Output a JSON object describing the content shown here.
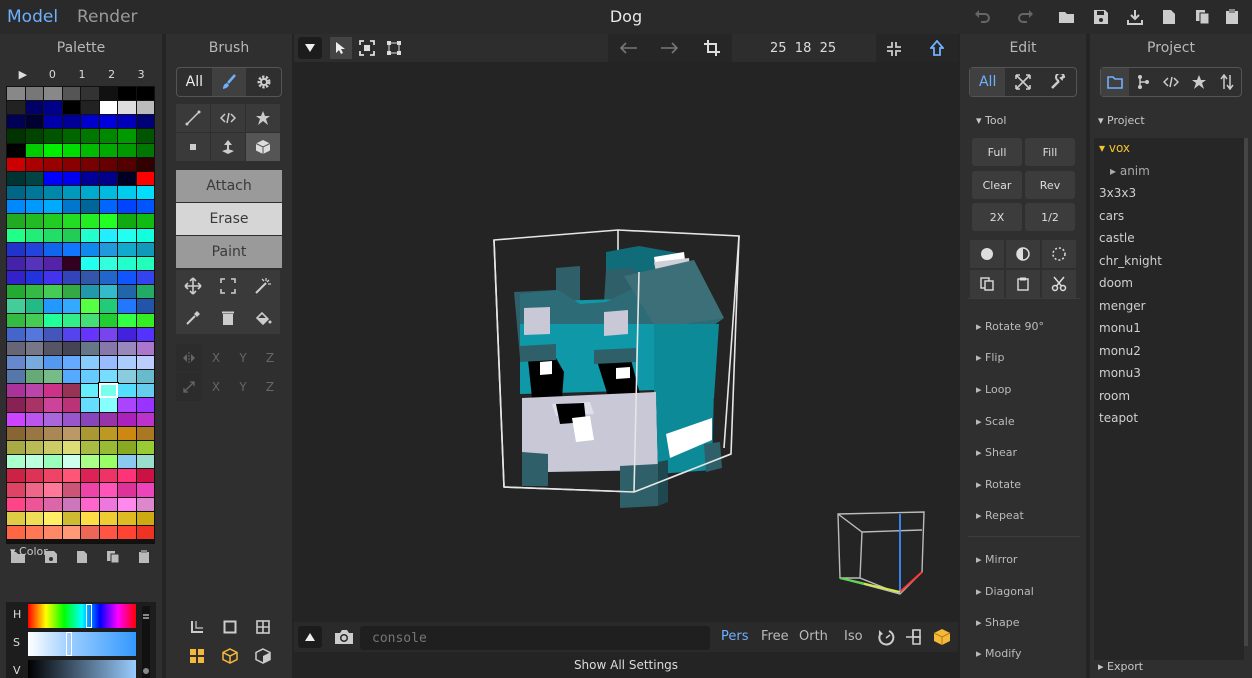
{
  "topbar": {
    "mode_tabs": [
      "Model",
      "Render"
    ],
    "title": "Dog",
    "icons": [
      "undo-icon",
      "redo-icon",
      "open-folder-icon",
      "save-icon",
      "download-icon",
      "new-file-icon",
      "copy-icon",
      "paste-icon"
    ]
  },
  "palette": {
    "title": "Palette",
    "columns": [
      "▶",
      "0",
      "1",
      "2",
      "3"
    ],
    "colors": [
      "#888888",
      "#777777",
      "#888888",
      "#555555",
      "#333333",
      "#111111",
      "#000000",
      "#000000",
      "#222222",
      "#000066",
      "#000088",
      "#000000",
      "#222222",
      "#ffffff",
      "#dddddd",
      "#bbbbbb",
      "#000055",
      "#000033",
      "#0000aa",
      "#000099",
      "#0000cc",
      "#0000dd",
      "#0000bb",
      "#000077",
      "#003300",
      "#004400",
      "#005500",
      "#006600",
      "#007700",
      "#008800",
      "#009900",
      "#005500",
      "#000000",
      "#00cc00",
      "#00ee00",
      "#00dd00",
      "#00bb00",
      "#00aa00",
      "#009900",
      "#007700",
      "#cc0000",
      "#aa0000",
      "#990000",
      "#880000",
      "#770000",
      "#660000",
      "#550000",
      "#330000",
      "#003333",
      "#004444",
      "#0000ff",
      "#0000ee",
      "#000099",
      "#000088",
      "#000022",
      "#ff0000",
      "#006688",
      "#007799",
      "#0088aa",
      "#0099bb",
      "#00aacc",
      "#00bbdd",
      "#00ccee",
      "#00ddff",
      "#0088ff",
      "#0099ff",
      "#00aaff",
      "#0077cc",
      "#006699",
      "#0066ff",
      "#0044ff",
      "#0055ff",
      "#22aa22",
      "#22bb22",
      "#22cc22",
      "#22dd22",
      "#22ee22",
      "#22ff22",
      "#11aa11",
      "#11bb11",
      "#22ff88",
      "#22ee77",
      "#22dd66",
      "#22cc55",
      "#22ffcc",
      "#22eeff",
      "#22ffee",
      "#11ffdd",
      "#2233cc",
      "#2244dd",
      "#1166ee",
      "#1177ff",
      "#1188ee",
      "#2299dd",
      "#11aacc",
      "#1199bb",
      "#4422aa",
      "#5533bb",
      "#5522aa",
      "#330022",
      "#22ffee",
      "#33ffdd",
      "#22ffcc",
      "#22ffbb",
      "#3322cc",
      "#2233dd",
      "#4433ee",
      "#3344bb",
      "#3355aa",
      "#2266cc",
      "#1155ff",
      "#3344ee",
      "#22aa33",
      "#33bb44",
      "#44cc55",
      "#33aa44",
      "#2299aa",
      "#33bbcc",
      "#2266aa",
      "#22aa66",
      "#44cc99",
      "#22bb88",
      "#2299ff",
      "#33aaff",
      "#55ff44",
      "#22cc77",
      "#2277ff",
      "#2255aa",
      "#33bb44",
      "#44cc55",
      "#22ff99",
      "#33ee88",
      "#44dd77",
      "#22cc33",
      "#33ff44",
      "#33ee22",
      "#4466cc",
      "#5577dd",
      "#4455bb",
      "#5544ee",
      "#6633ff",
      "#7744ee",
      "#4422dd",
      "#5533ff",
      "#666677",
      "#777788",
      "#555566",
      "#444455",
      "#667788",
      "#8877aa",
      "#9988bb",
      "#aa77cc",
      "#6688cc",
      "#77aadd",
      "#5599ee",
      "#66aaff",
      "#88ccff",
      "#99bbff",
      "#aaccff",
      "#bbccff",
      "#5577aa",
      "#66aa77",
      "#77bb88",
      "#55aaff",
      "#66ccff",
      "#77ddff",
      "#88ccdd",
      "#66bbcc",
      "#aa3399",
      "#bb44aa",
      "#cc3388",
      "#993355",
      "#66eeff",
      "#77ffee",
      "#55ddff",
      "#66ccee",
      "#882255",
      "#aa3366",
      "#cc4499",
      "#bb3377",
      "#66ddff",
      "#88ffff",
      "#aa44ff",
      "#9933ff",
      "#cc44ff",
      "#bb55ee",
      "#aa66dd",
      "#9955cc",
      "#8844bb",
      "#9933aa",
      "#aa22bb",
      "#bb33cc",
      "#886633",
      "#997744",
      "#aa8855",
      "#bb9966",
      "#aa9933",
      "#bb9922",
      "#cc8811",
      "#aa7722",
      "#aaaa44",
      "#bbbb55",
      "#cccc66",
      "#dddd77",
      "#aabb44",
      "#99bb33",
      "#88aa22",
      "#99cc33",
      "#aaffcc",
      "#bbffdd",
      "#99ffbb",
      "#ccffee",
      "#aaff88",
      "#99ff66",
      "#8acaf0",
      "#99ddcc",
      "#cc2244",
      "#dd3355",
      "#ee4466",
      "#ff5577",
      "#dd2255",
      "#ee3366",
      "#ff3377",
      "#cc1144",
      "#dd4466",
      "#ee6688",
      "#ff7799",
      "#cc5577",
      "#ee44aa",
      "#ff55bb",
      "#dd3399",
      "#ee44bb",
      "#ff4488",
      "#ee5599",
      "#dd66aa",
      "#cc77bb",
      "#ff66cc",
      "#ee77dd",
      "#ff88ee",
      "#dd88cc",
      "#ddcc44",
      "#eedd55",
      "#ffee66",
      "#ccbb33",
      "#ffdd44",
      "#eecc33",
      "#ddbb22",
      "#ccaa11",
      "#ff6644",
      "#ff7755",
      "#ff8866",
      "#ff9977",
      "#ee6655",
      "#ff5544",
      "#ff4433",
      "#ee3322",
      "#ffcc44",
      "#ffdd55",
      "#ffee77",
      "#ffaa33",
      "#ffbb44",
      "#ffcc66",
      "#ff9933",
      "#ffaa55",
      "#ff66cc",
      "#ff77dd",
      "#ff88ee",
      "#ff55bb",
      "#ff44aa",
      "#ff3399",
      "#ff2288",
      "#ff1177",
      "#ffee44",
      "#ffff55",
      "#ffff66",
      "#ffee33",
      "#ffdd22",
      "#ffcc11",
      "#ffbb00",
      "#ffaa00",
      "#ff99aa",
      "#ffaabb",
      "#ffbbcc",
      "#ffccdd",
      "#ffddee",
      "#ffeeff",
      "#ffcccc",
      "#ffdddd"
    ],
    "selected_index": 173,
    "tools": [
      "open-folder-icon",
      "save-icon",
      "new-file-icon",
      "copy-icon",
      "paste-icon"
    ]
  },
  "color": {
    "label": "Color",
    "h": "H",
    "s": "S",
    "v": "V",
    "current_hex": "#99ccff",
    "r": "153",
    "g": "204",
    "b": "255"
  },
  "brush": {
    "title": "Brush",
    "tabs": [
      "All"
    ],
    "modes": [
      "Attach",
      "Erase",
      "Paint"
    ],
    "active_mode": "Erase",
    "axis": [
      "X",
      "Y",
      "Z"
    ]
  },
  "viewport": {
    "size_readout": "25  18  25",
    "console_placeholder": "console",
    "views": [
      "Pers",
      "Free",
      "Orth",
      "Iso"
    ],
    "active_view": "Pers",
    "show_all": "Show All Settings"
  },
  "edit": {
    "title": "Edit",
    "tab_all": "All",
    "tool_label": "Tool",
    "buttons": [
      "Full",
      "Fill",
      "Clear",
      "Rev",
      "2X",
      "1/2"
    ],
    "sections": [
      "Rotate 90°",
      "Flip",
      "Loop",
      "Scale",
      "Shear",
      "Rotate",
      "Repeat",
      "Mirror",
      "Diagonal",
      "Shape",
      "Modify"
    ]
  },
  "project": {
    "title": "Project",
    "root": "Project",
    "active": "vox",
    "sub": "anim",
    "items": [
      "3x3x3",
      "cars",
      "castle",
      "chr_knight",
      "doom",
      "menger",
      "monu1",
      "monu2",
      "monu3",
      "room",
      "teapot"
    ],
    "export": "Export"
  }
}
